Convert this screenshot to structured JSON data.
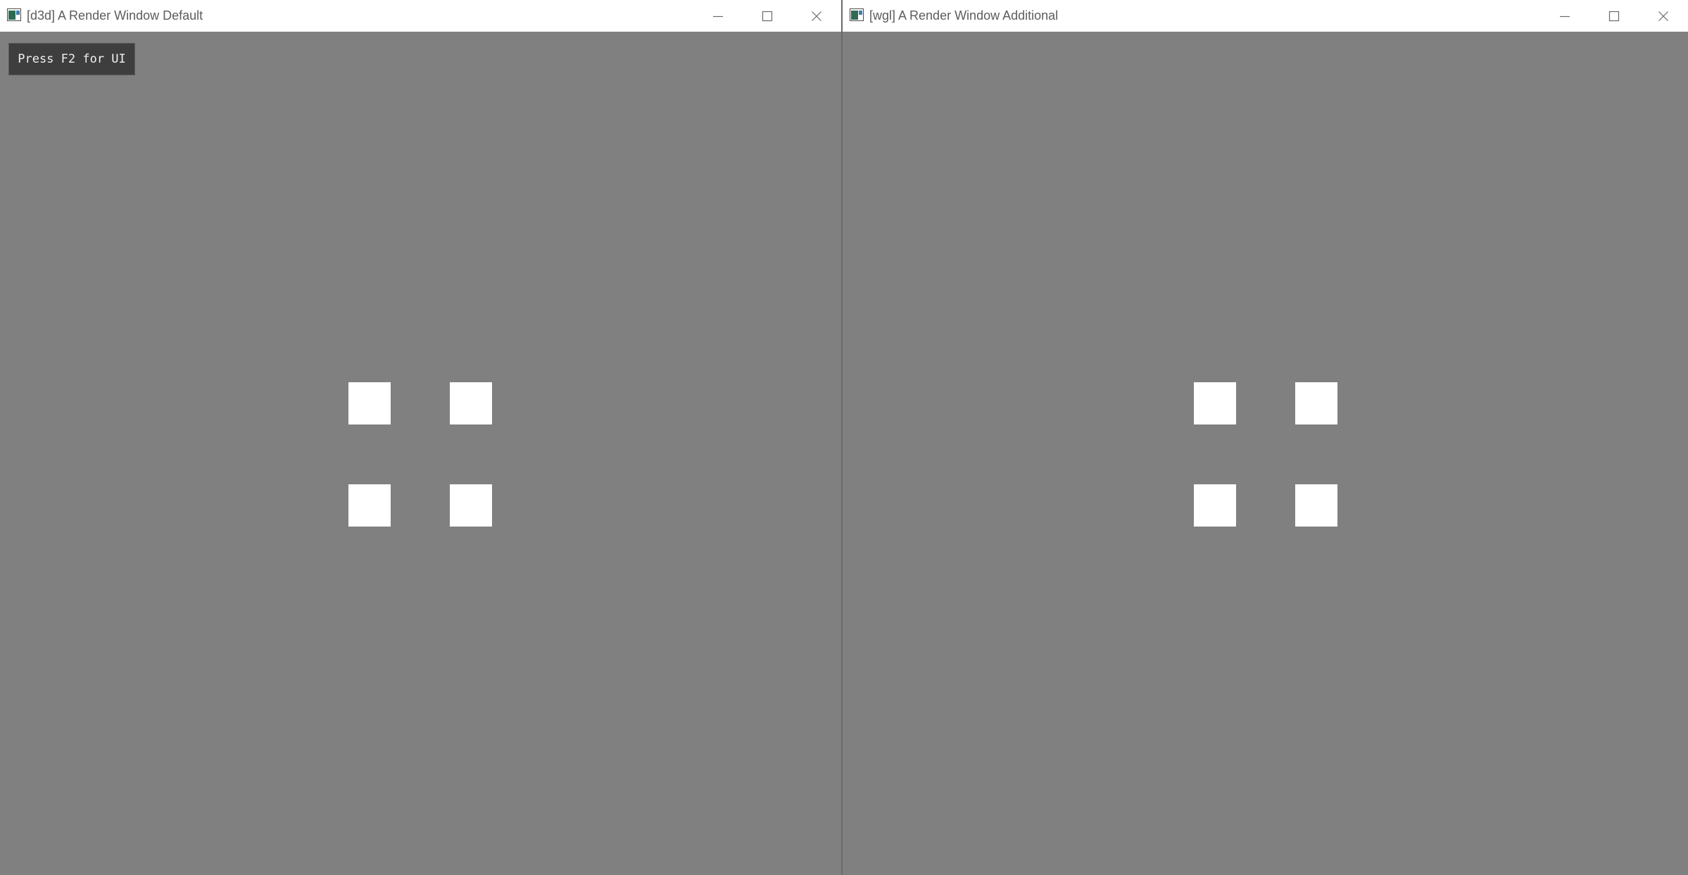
{
  "windows": [
    {
      "title": "[d3d] A Render Window Default",
      "overlay_hint": "Press F2 for UI",
      "controls": {
        "minimize": "minimize",
        "maximize": "maximize",
        "close": "close"
      },
      "scene": {
        "square_count": 4,
        "square_color": "#ffffff",
        "background_color": "#808080"
      }
    },
    {
      "title": "[wgl] A Render Window Additional",
      "controls": {
        "minimize": "minimize",
        "maximize": "maximize",
        "close": "close"
      },
      "scene": {
        "square_count": 4,
        "square_color": "#ffffff",
        "background_color": "#808080"
      }
    }
  ],
  "icons": {
    "app": "render-window-app-icon",
    "minimize": "minimize-icon",
    "maximize": "maximize-icon",
    "close": "close-icon"
  }
}
